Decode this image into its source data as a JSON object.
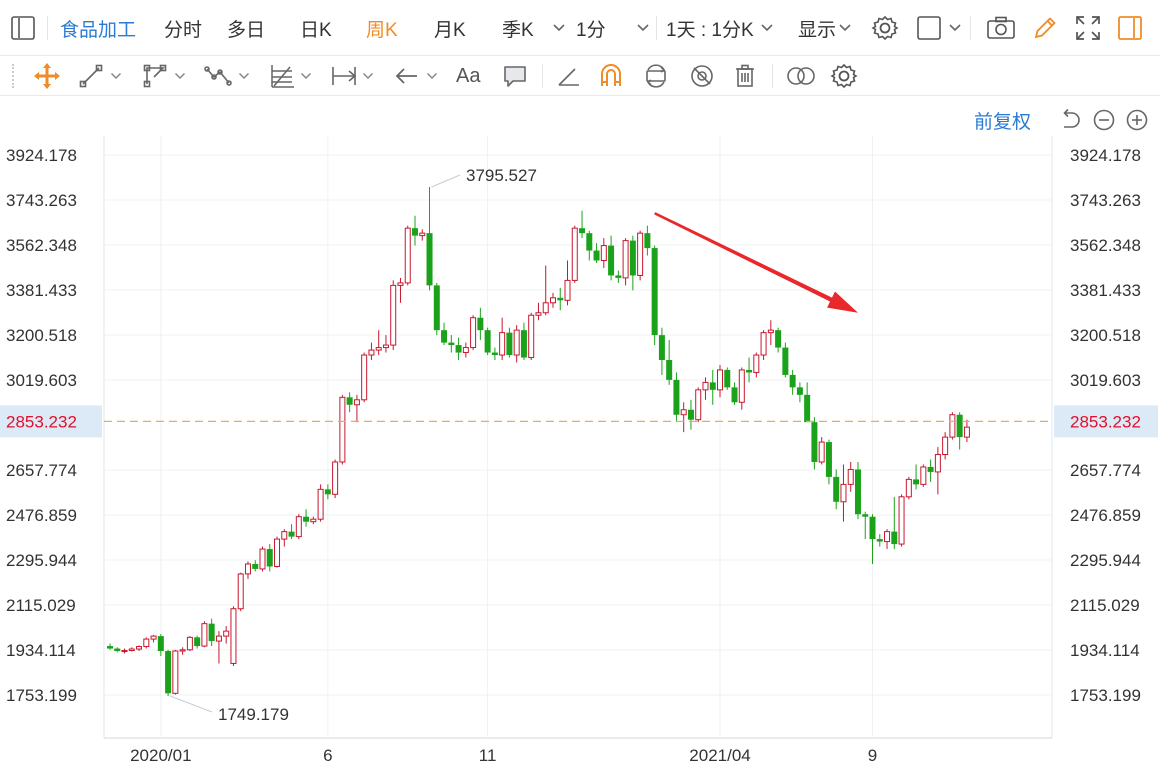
{
  "toolbar": {
    "menu_icon": "sidebar-toggle-icon",
    "stock_name": "食品加工",
    "periods": [
      "分时",
      "多日",
      "日K",
      "周K",
      "月K",
      "季K"
    ],
    "active_period": "周K",
    "minute_select": "1分",
    "range_select": "1天 : 1分K",
    "display_label": "显示"
  },
  "tools": [
    "move-icon",
    "line-icon",
    "polyline-icon",
    "wave-icon",
    "fib-icon",
    "range-icon",
    "arrow-icon",
    "text-icon",
    "comment-icon",
    "ruler-icon",
    "magnet-icon",
    "sync-icon",
    "hide-icon",
    "trash-icon",
    "link-icon",
    "settings-icon"
  ],
  "tool_text": "Aa",
  "controls": {
    "fuquan": "前复权"
  },
  "colors": {
    "up": "#c8172f",
    "down": "#1aa31a",
    "accent": "#2a7bd4",
    "active": "#f08c28",
    "price_line": "#f0a860",
    "last_price_bg": "#dce9f7",
    "arrow": "#e8282b"
  },
  "chart_data": {
    "type": "candlestick",
    "y_ticks": [
      "3924.178",
      "3743.263",
      "3562.348",
      "3381.433",
      "3200.518",
      "3019.603",
      "2657.774",
      "2476.859",
      "2295.944",
      "2115.029",
      "1934.114",
      "1753.199"
    ],
    "y_tick_values": [
      3924.178,
      3743.263,
      3562.348,
      3381.433,
      3200.518,
      3019.603,
      2657.774,
      2476.859,
      2295.944,
      2115.029,
      1934.114,
      1753.199
    ],
    "last_price": "2853.232",
    "last_price_value": 2853.232,
    "x_ticks": [
      {
        "label": "2020/01",
        "index": 7
      },
      {
        "label": "6",
        "index": 30
      },
      {
        "label": "11",
        "index": 52
      },
      {
        "label": "2021/04",
        "index": 84
      },
      {
        "label": "9",
        "index": 105
      }
    ],
    "high_label": "3795.527",
    "high_index": 44,
    "low_label": "1749.179",
    "low_index": 8,
    "arrow": {
      "from": [
        75,
        3690
      ],
      "to": [
        103,
        3290
      ]
    },
    "candles": [
      [
        1950,
        1960,
        1935,
        1940
      ],
      [
        1940,
        1945,
        1925,
        1930
      ],
      [
        1930,
        1940,
        1920,
        1932
      ],
      [
        1932,
        1945,
        1928,
        1938
      ],
      [
        1938,
        1952,
        1930,
        1948
      ],
      [
        1948,
        1985,
        1940,
        1978
      ],
      [
        1978,
        1995,
        1965,
        1990
      ],
      [
        1990,
        1998,
        1910,
        1930
      ],
      [
        1930,
        1935,
        1749,
        1760
      ],
      [
        1760,
        1935,
        1755,
        1930
      ],
      [
        1930,
        1945,
        1915,
        1935
      ],
      [
        1935,
        1990,
        1930,
        1985
      ],
      [
        1985,
        1992,
        1940,
        1950
      ],
      [
        1950,
        2050,
        1945,
        2040
      ],
      [
        2040,
        2060,
        1950,
        1970
      ],
      [
        1970,
        2010,
        1880,
        1990
      ],
      [
        1990,
        2030,
        1960,
        2010
      ],
      [
        1880,
        2110,
        1870,
        2100
      ],
      [
        2100,
        2245,
        2090,
        2240
      ],
      [
        2240,
        2290,
        2220,
        2280
      ],
      [
        2280,
        2295,
        2250,
        2260
      ],
      [
        2260,
        2350,
        2250,
        2340
      ],
      [
        2340,
        2360,
        2250,
        2270
      ],
      [
        2270,
        2390,
        2265,
        2380
      ],
      [
        2380,
        2420,
        2350,
        2410
      ],
      [
        2410,
        2440,
        2380,
        2390
      ],
      [
        2390,
        2480,
        2380,
        2470
      ],
      [
        2470,
        2500,
        2430,
        2450
      ],
      [
        2450,
        2470,
        2440,
        2460
      ],
      [
        2460,
        2600,
        2450,
        2580
      ],
      [
        2580,
        2600,
        2540,
        2560
      ],
      [
        2560,
        2700,
        2545,
        2690
      ],
      [
        2690,
        2960,
        2680,
        2950
      ],
      [
        2950,
        2970,
        2890,
        2920
      ],
      [
        2920,
        2960,
        2850,
        2940
      ],
      [
        2940,
        3130,
        2930,
        3120
      ],
      [
        3120,
        3170,
        3100,
        3140
      ],
      [
        3140,
        3220,
        3120,
        3150
      ],
      [
        3150,
        3200,
        3130,
        3160
      ],
      [
        3160,
        3420,
        3140,
        3400
      ],
      [
        3400,
        3430,
        3330,
        3410
      ],
      [
        3410,
        3640,
        3400,
        3630
      ],
      [
        3630,
        3680,
        3560,
        3600
      ],
      [
        3600,
        3625,
        3580,
        3610
      ],
      [
        3610,
        3795.527,
        3380,
        3400
      ],
      [
        3400,
        3410,
        3200,
        3220
      ],
      [
        3220,
        3250,
        3160,
        3170
      ],
      [
        3170,
        3200,
        3130,
        3160
      ],
      [
        3160,
        3190,
        3100,
        3130
      ],
      [
        3130,
        3170,
        3110,
        3150
      ],
      [
        3150,
        3280,
        3140,
        3270
      ],
      [
        3270,
        3310,
        3180,
        3220
      ],
      [
        3220,
        3230,
        3120,
        3130
      ],
      [
        3130,
        3150,
        3100,
        3120
      ],
      [
        3120,
        3270,
        3100,
        3210
      ],
      [
        3210,
        3230,
        3110,
        3120
      ],
      [
        3120,
        3240,
        3090,
        3220
      ],
      [
        3220,
        3250,
        3100,
        3110
      ],
      [
        3110,
        3290,
        3100,
        3280
      ],
      [
        3280,
        3330,
        3260,
        3290
      ],
      [
        3290,
        3480,
        3280,
        3330
      ],
      [
        3330,
        3370,
        3310,
        3350
      ],
      [
        3350,
        3390,
        3300,
        3340
      ],
      [
        3340,
        3500,
        3320,
        3420
      ],
      [
        3420,
        3640,
        3410,
        3630
      ],
      [
        3630,
        3700,
        3590,
        3610
      ],
      [
        3610,
        3620,
        3500,
        3540
      ],
      [
        3540,
        3570,
        3490,
        3500
      ],
      [
        3500,
        3590,
        3470,
        3560
      ],
      [
        3560,
        3600,
        3420,
        3440
      ],
      [
        3440,
        3460,
        3410,
        3430
      ],
      [
        3430,
        3590,
        3400,
        3580
      ],
      [
        3580,
        3600,
        3380,
        3440
      ],
      [
        3440,
        3620,
        3420,
        3610
      ],
      [
        3610,
        3640,
        3520,
        3550
      ],
      [
        3550,
        3560,
        3160,
        3200
      ],
      [
        3200,
        3230,
        3040,
        3100
      ],
      [
        3100,
        3180,
        3000,
        3020
      ],
      [
        3020,
        3050,
        2850,
        2880
      ],
      [
        2880,
        2930,
        2810,
        2900
      ],
      [
        2900,
        2940,
        2820,
        2860
      ],
      [
        2860,
        2990,
        2850,
        2980
      ],
      [
        2980,
        3030,
        2940,
        3010
      ],
      [
        3010,
        3060,
        2920,
        2980
      ],
      [
        2980,
        3080,
        2950,
        3060
      ],
      [
        3060,
        3070,
        2980,
        2990
      ],
      [
        2990,
        3010,
        2920,
        2930
      ],
      [
        2930,
        3070,
        2900,
        3060
      ],
      [
        3060,
        3110,
        3010,
        3050
      ],
      [
        3050,
        3130,
        3030,
        3120
      ],
      [
        3120,
        3220,
        3100,
        3210
      ],
      [
        3210,
        3260,
        3160,
        3220
      ],
      [
        3220,
        3230,
        3130,
        3150
      ],
      [
        3150,
        3170,
        3030,
        3040
      ],
      [
        3040,
        3060,
        2960,
        2990
      ],
      [
        2990,
        3010,
        2930,
        2960
      ],
      [
        2960,
        3010,
        2880,
        2850
      ],
      [
        2850,
        2870,
        2660,
        2690
      ],
      [
        2690,
        2790,
        2680,
        2770
      ],
      [
        2770,
        2780,
        2600,
        2630
      ],
      [
        2630,
        2660,
        2500,
        2530
      ],
      [
        2530,
        2680,
        2450,
        2600
      ],
      [
        2600,
        2690,
        2570,
        2660
      ],
      [
        2660,
        2690,
        2460,
        2480
      ],
      [
        2480,
        2490,
        2380,
        2470
      ],
      [
        2470,
        2480,
        2280,
        2380
      ],
      [
        2380,
        2400,
        2350,
        2370
      ],
      [
        2370,
        2420,
        2340,
        2410
      ],
      [
        2410,
        2550,
        2340,
        2360
      ],
      [
        2360,
        2560,
        2350,
        2550
      ],
      [
        2550,
        2630,
        2540,
        2620
      ],
      [
        2620,
        2680,
        2580,
        2600
      ],
      [
        2600,
        2680,
        2590,
        2670
      ],
      [
        2670,
        2700,
        2610,
        2650
      ],
      [
        2650,
        2750,
        2560,
        2720
      ],
      [
        2720,
        2810,
        2700,
        2790
      ],
      [
        2790,
        2890,
        2780,
        2880
      ],
      [
        2880,
        2890,
        2740,
        2790
      ],
      [
        2790,
        2860,
        2770,
        2830
      ]
    ]
  }
}
